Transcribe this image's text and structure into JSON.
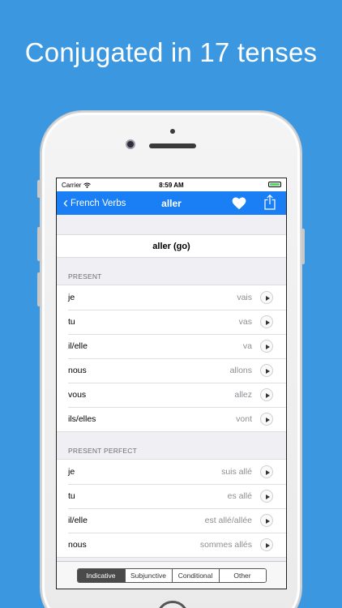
{
  "headline": "Conjugated in 17 tenses",
  "status_bar": {
    "carrier": "Carrier",
    "time": "8:59 AM"
  },
  "nav": {
    "back_label": "French Verbs",
    "title": "aller",
    "heart_icon": "heart-icon",
    "share_icon": "share-icon"
  },
  "verb_header": "aller (go)",
  "sections": [
    {
      "title": "PRESENT",
      "rows": [
        {
          "pronoun": "je",
          "form": "vais"
        },
        {
          "pronoun": "tu",
          "form": "vas"
        },
        {
          "pronoun": "il/elle",
          "form": "va"
        },
        {
          "pronoun": "nous",
          "form": "allons"
        },
        {
          "pronoun": "vous",
          "form": "allez"
        },
        {
          "pronoun": "ils/elles",
          "form": "vont"
        }
      ]
    },
    {
      "title": "PRESENT PERFECT",
      "rows": [
        {
          "pronoun": "je",
          "form": "suis allé"
        },
        {
          "pronoun": "tu",
          "form": "es allé"
        },
        {
          "pronoun": "il/elle",
          "form": "est allé/allée"
        },
        {
          "pronoun": "nous",
          "form": "sommes allés"
        }
      ]
    }
  ],
  "segments": [
    "Indicative",
    "Subjunctive",
    "Conditional",
    "Other"
  ],
  "active_segment": "Indicative",
  "colors": {
    "background": "#3b97e0",
    "nav_bar": "#1a7ff5",
    "battery": "#4cd964"
  }
}
